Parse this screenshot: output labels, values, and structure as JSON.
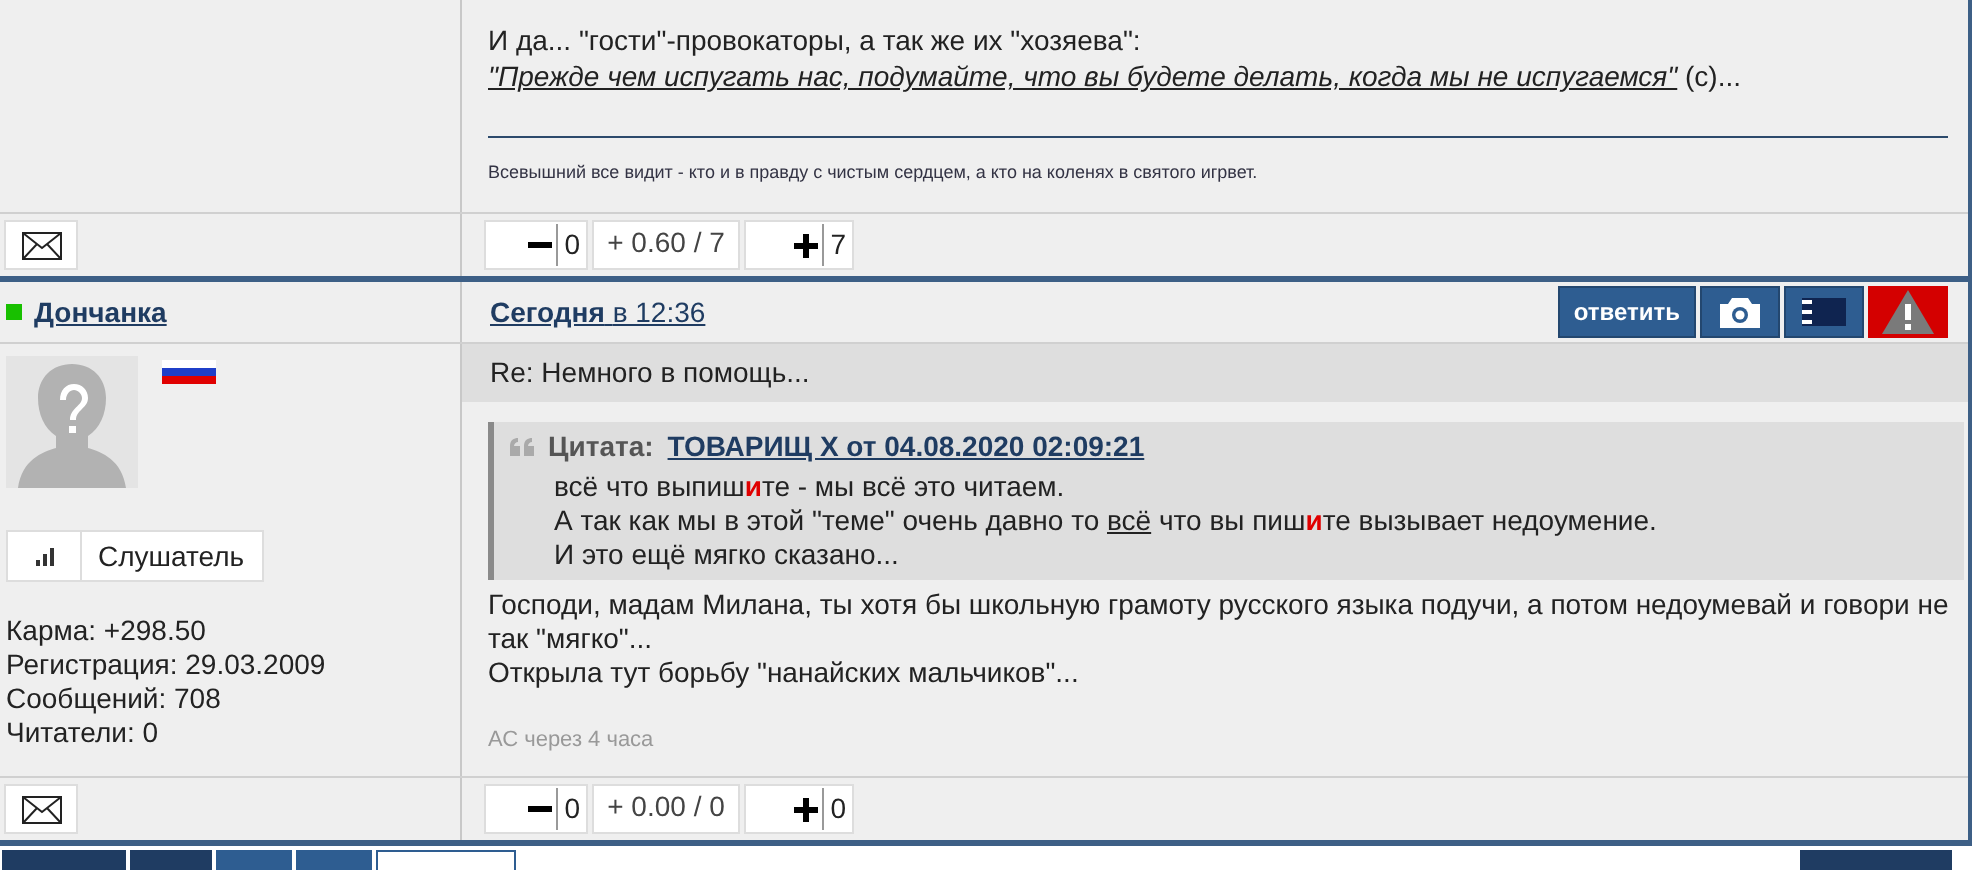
{
  "posts": [
    {
      "body": [
        [
          {
            "kind": "plain",
            "text": "И да... \"гости\"-провокаторы, а так же их \"хозяева\":"
          }
        ],
        [
          {
            "kind": "quote_link",
            "text": "\"Прежде чем испугать нас, подумайте, что вы будете делать, когда мы не испугаемся\""
          },
          {
            "kind": "plain",
            "text": " (c)..."
          }
        ]
      ],
      "signature": "Всевышний все видит - кто и в правду с чистым сердцем, а кто на коленях в святого игрвет.",
      "rating": {
        "minus": "0",
        "score": "+ 0.60 / 7",
        "plus": "7"
      }
    },
    {
      "author": {
        "name": "Дончанка",
        "online": true,
        "rank": "Слушатель",
        "stats": [
          "Карма: +298.50",
          "Регистрация: 29.03.2009",
          "Сообщений: 708",
          "Читатели: 0"
        ]
      },
      "date": {
        "day": "Сегодня",
        "time": "в 12:36"
      },
      "reply_label": "ответить",
      "subject": "Re: Немного в помощь...",
      "quote": {
        "label": "Цитата:",
        "source": "ТОВАРИЩ Х от 04.08.2020 02:09:21",
        "lines": [
          [
            {
              "kind": "plain",
              "text": "всё что выпиш"
            },
            {
              "kind": "red",
              "text": "и"
            },
            {
              "kind": "plain",
              "text": "те - мы всё это читаем."
            }
          ],
          [
            {
              "kind": "plain",
              "text": "А так как мы в этой \"теме\" очень давно то "
            },
            {
              "kind": "underline",
              "text": "всё"
            },
            {
              "kind": "plain",
              "text": " что вы пиш"
            },
            {
              "kind": "red",
              "text": "и"
            },
            {
              "kind": "plain",
              "text": "те вызывает недоумение."
            }
          ],
          [
            {
              "kind": "plain",
              "text": "И это ещё мягко сказано..."
            }
          ]
        ]
      },
      "body": [
        [
          {
            "kind": "plain",
            "text": "Господи, мадам Милана, ты хотя бы школьную грамоту русского языка подучи, а потом недоумевай и говори не так \"мягко\"..."
          }
        ],
        [
          {
            "kind": "plain",
            "text": "Открыла тут борьбу \"нанайских мальчиков\"..."
          }
        ]
      ],
      "edit_note": "АС через 4 часа",
      "rating": {
        "minus": "0",
        "score": "+ 0.00 / 0",
        "plus": "0"
      }
    }
  ]
}
